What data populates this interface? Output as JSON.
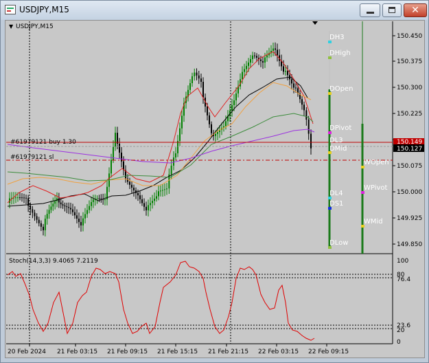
{
  "window": {
    "title": "USDJPY,M15",
    "controls": {
      "minimize": "minimize",
      "maximize": "maximize",
      "close": "✕"
    }
  },
  "chart": {
    "header_symbol": "USDJPY,M15",
    "price_axis": [
      "150.450",
      "150.375",
      "150.300",
      "150.225",
      "150.150",
      "150.075",
      "150.000",
      "149.925",
      "149.850"
    ],
    "current_price": "150.127",
    "upper_price_tag": "150.149",
    "order_buy_label": "#61979121 buy 1.30",
    "order_sl_label": "#61979121 sl",
    "level_labels": [
      "DH3",
      "DHigh",
      "DOpen",
      "DPivot",
      "DL3",
      "DMid",
      "DL4",
      "DS1",
      "DLow",
      "WOpen",
      "WPivot",
      "WMid"
    ],
    "stoch_label": "Stoch(14,3,3) 9.4065 7.2119",
    "stoch_axis": [
      "100",
      "80",
      "76.4",
      "23.6",
      "20",
      "0"
    ],
    "time_axis": [
      "20 Feb 2024",
      "21 Feb 03:15",
      "21 Feb 09:15",
      "21 Feb 15:15",
      "21 Feb 21:15",
      "22 Feb 03:15",
      "22 Feb 09:15"
    ]
  },
  "colors": {
    "bull": "#008000",
    "bear": "#000000",
    "ma_red": "#e02020",
    "ma_black": "#000000",
    "ma_orange": "#f0a040",
    "ma_green": "#3c8c3c",
    "ma_purple": "#9b30e0",
    "order_line": "#c00000",
    "stoch": "#e00000"
  }
}
